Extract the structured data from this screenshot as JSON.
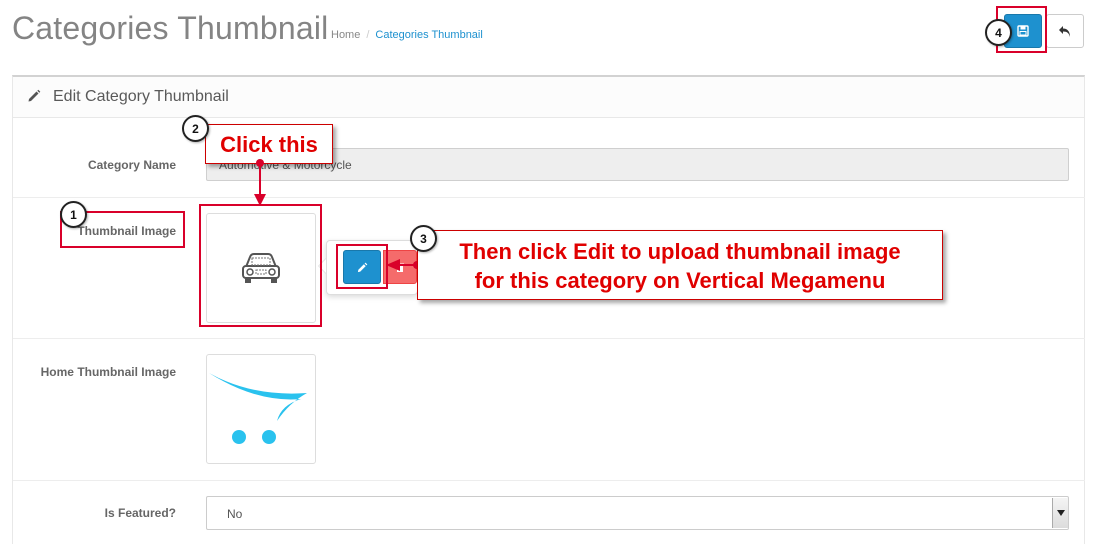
{
  "page": {
    "title": "Categories Thumbnail",
    "breadcrumb": [
      "Home",
      "Categories Thumbnail"
    ]
  },
  "toolbar": {
    "save_icon": "save-icon",
    "back_icon": "reply-icon"
  },
  "panel": {
    "heading": "Edit Category Thumbnail",
    "heading_icon": "pencil-icon"
  },
  "form": {
    "category_name_label": "Category Name",
    "category_name_value": "Automotive & Motorcycle",
    "thumbnail_label": "Thumbnail Image",
    "home_thumbnail_label": "Home Thumbnail Image",
    "is_featured_label": "Is Featured?",
    "is_featured_value": "No"
  },
  "annotations": {
    "step1": "1",
    "step2": "2",
    "step3": "3",
    "step4": "4",
    "click_this": "Click this",
    "edit_instruction_line1": "Then click Edit to upload thumbnail image",
    "edit_instruction_line2": "for this category on Vertical Megamenu"
  },
  "colors": {
    "primary": "#1e91cf",
    "danger": "#f56b6b",
    "annotation_red": "#d9002a"
  }
}
